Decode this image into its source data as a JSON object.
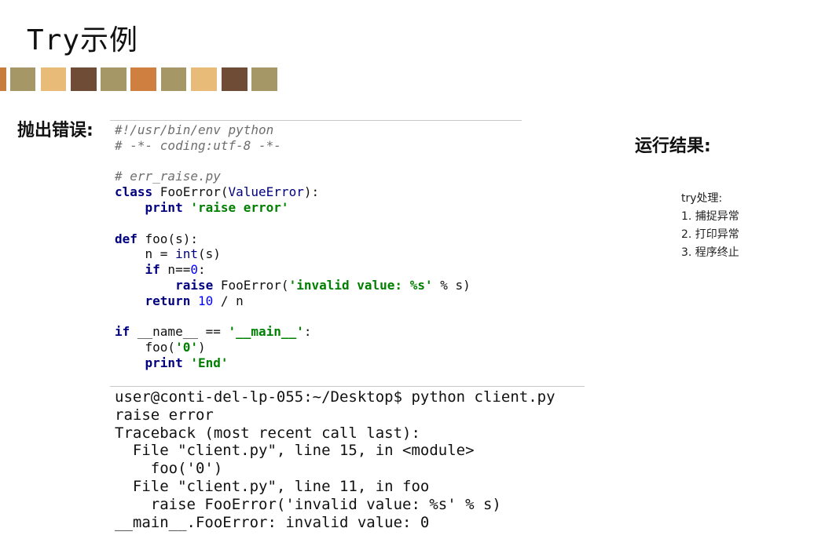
{
  "slide": {
    "title": "Try示例",
    "stripe_colors": [
      "#c97d3d",
      "#a59766",
      "#e8bc78",
      "#6f4c36",
      "#a59766",
      "#cf8040",
      "#a59766",
      "#e8bc78",
      "#6f4c36",
      "#a59766"
    ]
  },
  "labels": {
    "throw_error": "抛出错误:",
    "run_result": "运行结果:"
  },
  "notes": {
    "heading": "try处理:",
    "items": [
      "1. 捕捉异常",
      "2. 打印异常",
      "3. 程序终止"
    ]
  },
  "code": {
    "l1": "#!/usr/bin/env python",
    "l2": "# -*- coding:utf-8 -*-",
    "l4": "# err_raise.py",
    "l5_kw": "class",
    "l5_name": " FooError(",
    "l5_base": "ValueError",
    "l5_end": "):",
    "l6_kw": "    print",
    "l6_str": " 'raise error'",
    "l8_kw": "def",
    "l8_rest": " foo(s):",
    "l9_a": "    n = ",
    "l9_bi": "int",
    "l9_b": "(s)",
    "l10_kw": "    if",
    "l10_a": " n==",
    "l10_num": "0",
    "l10_b": ":",
    "l11_kw": "        raise",
    "l11_a": " FooError(",
    "l11_str": "'invalid value: %s'",
    "l11_b": " % s)",
    "l12_kw": "    return",
    "l12_num": " 10",
    "l12_a": " / n",
    "l14_kw": "if",
    "l14_a": " __name__ == ",
    "l14_str": "'__main__'",
    "l14_b": ":",
    "l15_a": "    foo(",
    "l15_str": "'0'",
    "l15_b": ")",
    "l16_kw": "    print",
    "l16_str": " 'End'"
  },
  "terminal": {
    "lines": [
      "user@conti-del-lp-055:~/Desktop$ python client.py",
      "raise error",
      "Traceback (most recent call last):",
      "  File \"client.py\", line 15, in <module>",
      "    foo('0')",
      "  File \"client.py\", line 11, in foo",
      "    raise FooError('invalid value: %s' % s)",
      "__main__.FooError: invalid value: 0"
    ]
  }
}
